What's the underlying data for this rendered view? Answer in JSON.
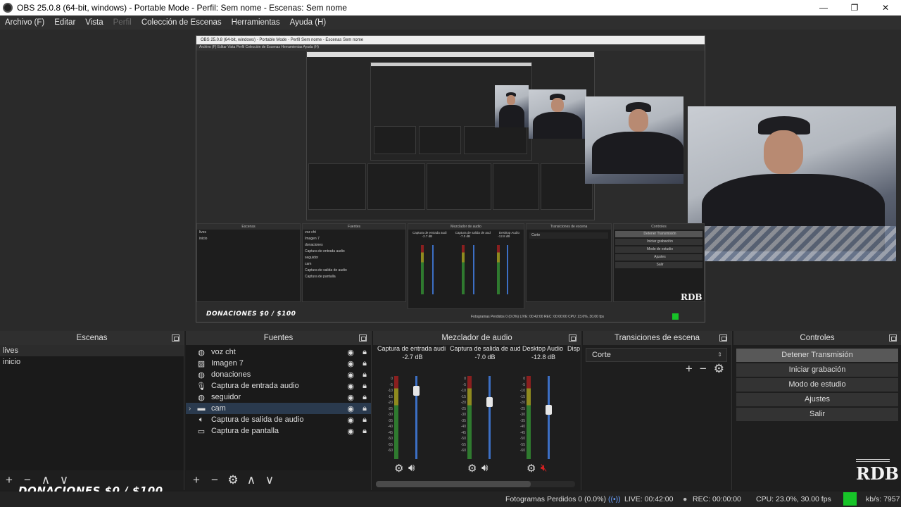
{
  "window": {
    "title": "OBS 25.0.8 (64-bit, windows) - Portable Mode - Perfil: Sem nome - Escenas: Sem nome",
    "minimize": "—",
    "maximize": "❐",
    "close": "✕"
  },
  "menu": [
    "Archivo (F)",
    "Editar",
    "Vista",
    "Perfil",
    "Colección de Escenas",
    "Herramientas",
    "Ayuda (H)"
  ],
  "preview": {
    "nested_title": "OBS 25.0.8 (64-bit, windows) - Portable Mode - Perfil Sem nome - Escenas Sem nome",
    "nested_menu": "Archivo (F)   Editar   Vista   Perfil   Colección de Escenas   Herramientas   Ayuda (H)",
    "nested_docks": [
      "Escenas",
      "Fuentes",
      "Mezclador de audio",
      "Transiciones de escena",
      "Controles"
    ],
    "nested_scenes": [
      "lives",
      "inicio"
    ],
    "nested_sources": [
      "voz cht",
      "Imagen 7",
      "donaciones",
      "Captura de entrada audio",
      "seguidor",
      "cam",
      "Captura de salida de audio",
      "Captura de pantalla"
    ],
    "nested_controls": [
      "Detener Transmisión",
      "Iniciar grabación",
      "Modo de estudio",
      "Ajustes",
      "Salir"
    ],
    "nested_mixer": [
      "Captura de entrada audi",
      "Captura de salida de aud",
      "Desktop Audio"
    ],
    "nested_db": [
      "-2.7 dB",
      "-7.0 dB",
      "-12.8 dB"
    ],
    "nested_transition": "Corte",
    "nested_donation": "DONACIONES $0 / $100",
    "nested_status": "Fotogramas Perdidos 0 (0.0%)   LIVE: 00:42:00   REC: 00:00:00   CPU: 23.6%, 30.00 fps"
  },
  "scenes": {
    "header": "Escenas",
    "items": [
      "lives",
      "inicio"
    ],
    "toolbar": [
      "+",
      "−",
      "∧",
      "∨"
    ]
  },
  "sources": {
    "header": "Fuentes",
    "items": [
      {
        "name": "voz cht",
        "icon": "globe-icon"
      },
      {
        "name": "Imagen 7",
        "icon": "image-icon"
      },
      {
        "name": "donaciones",
        "icon": "globe-icon"
      },
      {
        "name": "Captura de entrada audio",
        "icon": "microphone-icon"
      },
      {
        "name": "seguidor",
        "icon": "globe-icon"
      },
      {
        "name": "cam",
        "icon": "folder-icon"
      },
      {
        "name": "Captura de salida de audio",
        "icon": "speaker-icon"
      },
      {
        "name": "Captura de pantalla",
        "icon": "monitor-icon"
      }
    ],
    "toolbar": [
      "+",
      "−",
      "⚙",
      "∧",
      "∨"
    ]
  },
  "mixer": {
    "header": "Mezclador de audio",
    "channels": [
      {
        "name": "Captura de entrada audi",
        "db": "-2.7 dB",
        "level": 0.88,
        "muted": false
      },
      {
        "name": "Captura de salida de aud",
        "db": "-7.0 dB",
        "level": 0.75,
        "muted": false
      },
      {
        "name": "Desktop Audio",
        "db": "-12.8 dB",
        "level": 0.65,
        "muted": true
      }
    ],
    "extra_channel": "Disp",
    "scale": [
      "0",
      "-5",
      "-10",
      "-15",
      "-20",
      "-25",
      "-30",
      "-35",
      "-40",
      "-45",
      "-50",
      "-55",
      "-60"
    ]
  },
  "transitions": {
    "header": "Transiciones de escena",
    "selected": "Corte",
    "toolbar": [
      "+",
      "−",
      "⚙"
    ]
  },
  "controls": {
    "header": "Controles",
    "buttons": [
      "Detener Transmisión",
      "Iniciar grabación",
      "Modo de estudio",
      "Ajustes",
      "Salir"
    ]
  },
  "overlay": {
    "donation": "DONACIONES $0 / $100",
    "logo": "RDB"
  },
  "status": {
    "dropped": "Fotogramas Perdidos 0 (0.0%)",
    "live": "LIVE: 00:42:00",
    "rec": "REC: 00:00:00",
    "cpu": "CPU: 23.0%, 30.00 fps",
    "kbps": "kb/s: 7957",
    "indicator_color": "#17c428"
  },
  "colors": {
    "accent": "#3c6fc4",
    "mute_red": "#d42020"
  }
}
